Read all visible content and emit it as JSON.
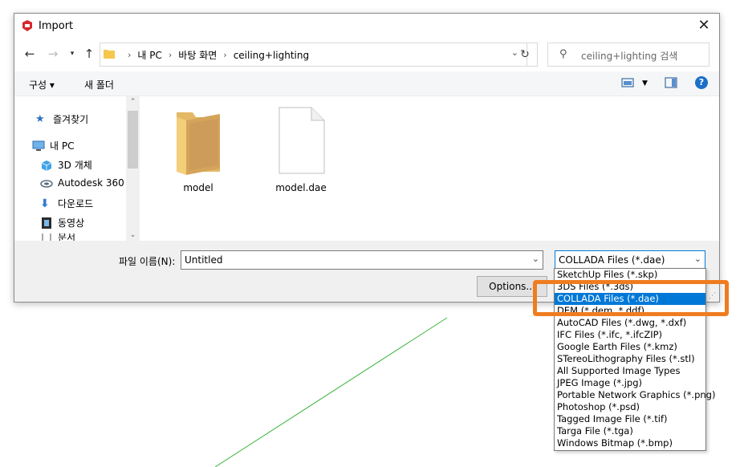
{
  "window": {
    "title": "Import",
    "close_label": "✕"
  },
  "address": {
    "crumbs": [
      "내 PC",
      "바탕 화면",
      "ceiling+lighting"
    ],
    "search_placeholder": "ceiling+lighting 검색"
  },
  "toolbar": {
    "organize_label": "구성 ▾",
    "new_folder_label": "새 폴더",
    "help_label": "?"
  },
  "navpane": {
    "items": [
      {
        "label": "즐겨찾기",
        "icon": "star-icon"
      },
      {
        "label": "내 PC",
        "icon": "computer-icon"
      },
      {
        "label": "3D 개체",
        "icon": "cube-icon"
      },
      {
        "label": "Autodesk 360",
        "icon": "cloud-icon"
      },
      {
        "label": "다운로드",
        "icon": "download-icon"
      },
      {
        "label": "동영상",
        "icon": "video-icon"
      },
      {
        "label": "문서",
        "icon": "document-icon"
      }
    ]
  },
  "files": [
    {
      "name": "model",
      "type": "folder"
    },
    {
      "name": "model.dae",
      "type": "file"
    }
  ],
  "bottom": {
    "filename_label": "파일 이름(N):",
    "filename_value": "Untitled",
    "filetype_value": "COLLADA Files (*.dae)",
    "options_label": "Options..."
  },
  "filetype_options": [
    "SketchUp Files (*.skp)",
    "3DS Files (*.3ds)",
    "COLLADA Files (*.dae)",
    "DEM (*.dem, *.ddf)",
    "AutoCAD Files (*.dwg, *.dxf)",
    "IFC Files (*.ifc, *.ifcZIP)",
    "Google Earth Files (*.kmz)",
    "STereoLithography Files (*.stl)",
    "All Supported Image Types",
    "JPEG Image (*.jpg)",
    "Portable Network Graphics (*.png)",
    "Photoshop (*.psd)",
    "Tagged Image File (*.tif)",
    "Targa File (*.tga)",
    "Windows Bitmap (*.bmp)"
  ],
  "selected_option_index": 2,
  "colors": {
    "accent": "#0078d7",
    "highlight": "#f07c1f",
    "bg_line": "#3cb43c"
  }
}
